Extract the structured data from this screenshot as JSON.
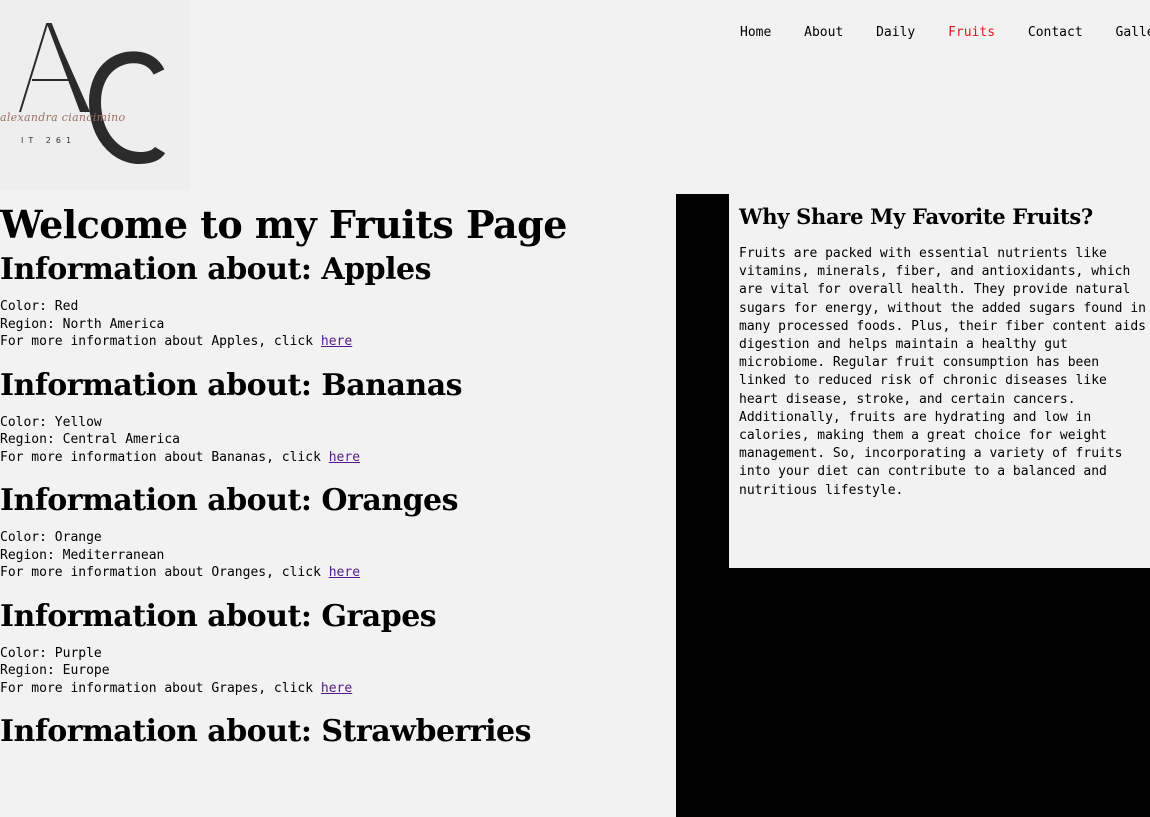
{
  "logo": {
    "monogram": "AC",
    "script_name": "alexandra ciancimino",
    "course": "IT 261"
  },
  "nav": {
    "items": [
      {
        "label": "Home",
        "active": false
      },
      {
        "label": "About",
        "active": false
      },
      {
        "label": "Daily",
        "active": false
      },
      {
        "label": "Fruits",
        "active": true
      },
      {
        "label": "Contact",
        "active": false
      },
      {
        "label": "Gallery",
        "active": false
      }
    ],
    "active_color": "#e01818"
  },
  "main": {
    "title": "Welcome to my Fruits Page",
    "fruits": [
      {
        "heading": "Information about: Apples",
        "color": "Color: Red",
        "region": "Region: North America",
        "more": "For more information about Apples, click ",
        "link": "here"
      },
      {
        "heading": "Information about: Bananas",
        "color": "Color: Yellow",
        "region": "Region: Central America",
        "more": "For more information about Bananas, click ",
        "link": "here"
      },
      {
        "heading": "Information about: Oranges",
        "color": "Color: Orange",
        "region": "Region: Mediterranean",
        "more": "For more information about Oranges, click ",
        "link": "here"
      },
      {
        "heading": "Information about: Grapes",
        "color": "Color: Purple",
        "region": "Region: Europe",
        "more": "For more information about Grapes, click ",
        "link": "here"
      },
      {
        "heading": "Information about: Strawberries"
      }
    ]
  },
  "aside": {
    "title": "Why Share My Favorite Fruits?",
    "body": "Fruits are packed with essential nutrients like vitamins, minerals, fiber, and antioxidants, which are vital for overall health. They provide natural sugars for energy, without the added sugars found in many processed foods. Plus, their fiber content aids digestion and helps maintain a healthy gut microbiome. Regular fruit consumption has been linked to reduced risk of chronic diseases like heart disease, stroke, and certain cancers. Additionally, fruits are hydrating and low in calories, making them a great choice for weight management. So, incorporating a variety of fruits into your diet can contribute to a balanced and nutritious lifestyle."
  }
}
